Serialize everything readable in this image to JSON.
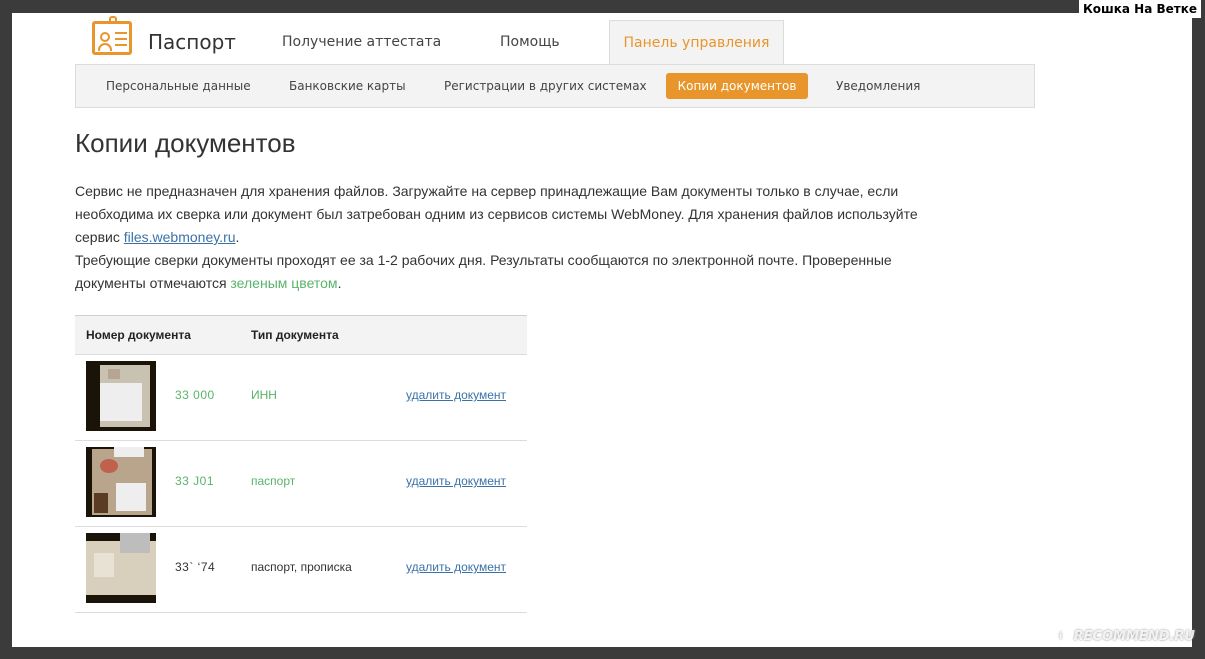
{
  "watermark": {
    "top": "Кошка На Ветке",
    "bottom": "RECOMMEND.RU"
  },
  "header": {
    "brand": "Паспорт",
    "nav": [
      "Получение аттестата",
      "Помощь",
      "Панель управления"
    ]
  },
  "subnav": {
    "items": [
      "Персональные данные",
      "Банковские карты",
      "Регистрации в других системах",
      "Копии документов",
      "Уведомления"
    ],
    "active": "Копии документов"
  },
  "title": "Копии документов",
  "description": {
    "line1": "Сервис не предназначен для хранения файлов. Загружайте на сервер принадлежащие Вам документы только в случае, если",
    "line2": "необходима их сверка или документ был затребован одним из сервисов системы WebMoney. Для хранения файлов используйте",
    "line3_prefix": "сервис ",
    "line3_link": "files.webmoney.ru",
    "line3_suffix": ".",
    "line4": "Требующие сверки документы проходят ее за 1-2 рабочих дня. Результаты сообщаются по электронной почте. Проверенные",
    "line5_prefix": "документы отмечаются ",
    "line5_green": "зеленым цветом",
    "line5_suffix": "."
  },
  "table": {
    "headers": [
      "Номер документа",
      "Тип документа"
    ],
    "rows": [
      {
        "number": "33     000",
        "type": "ИНН",
        "action": "удалить документ",
        "verified": true
      },
      {
        "number": "33     J01",
        "type": "паспорт",
        "action": "удалить документ",
        "verified": true
      },
      {
        "number": "33`   ‘74",
        "type": "паспорт, прописка",
        "action": "удалить документ",
        "verified": false
      }
    ]
  },
  "colors": {
    "accent": "#e8952b",
    "verified": "#58b46a",
    "link": "#3a72a8"
  }
}
